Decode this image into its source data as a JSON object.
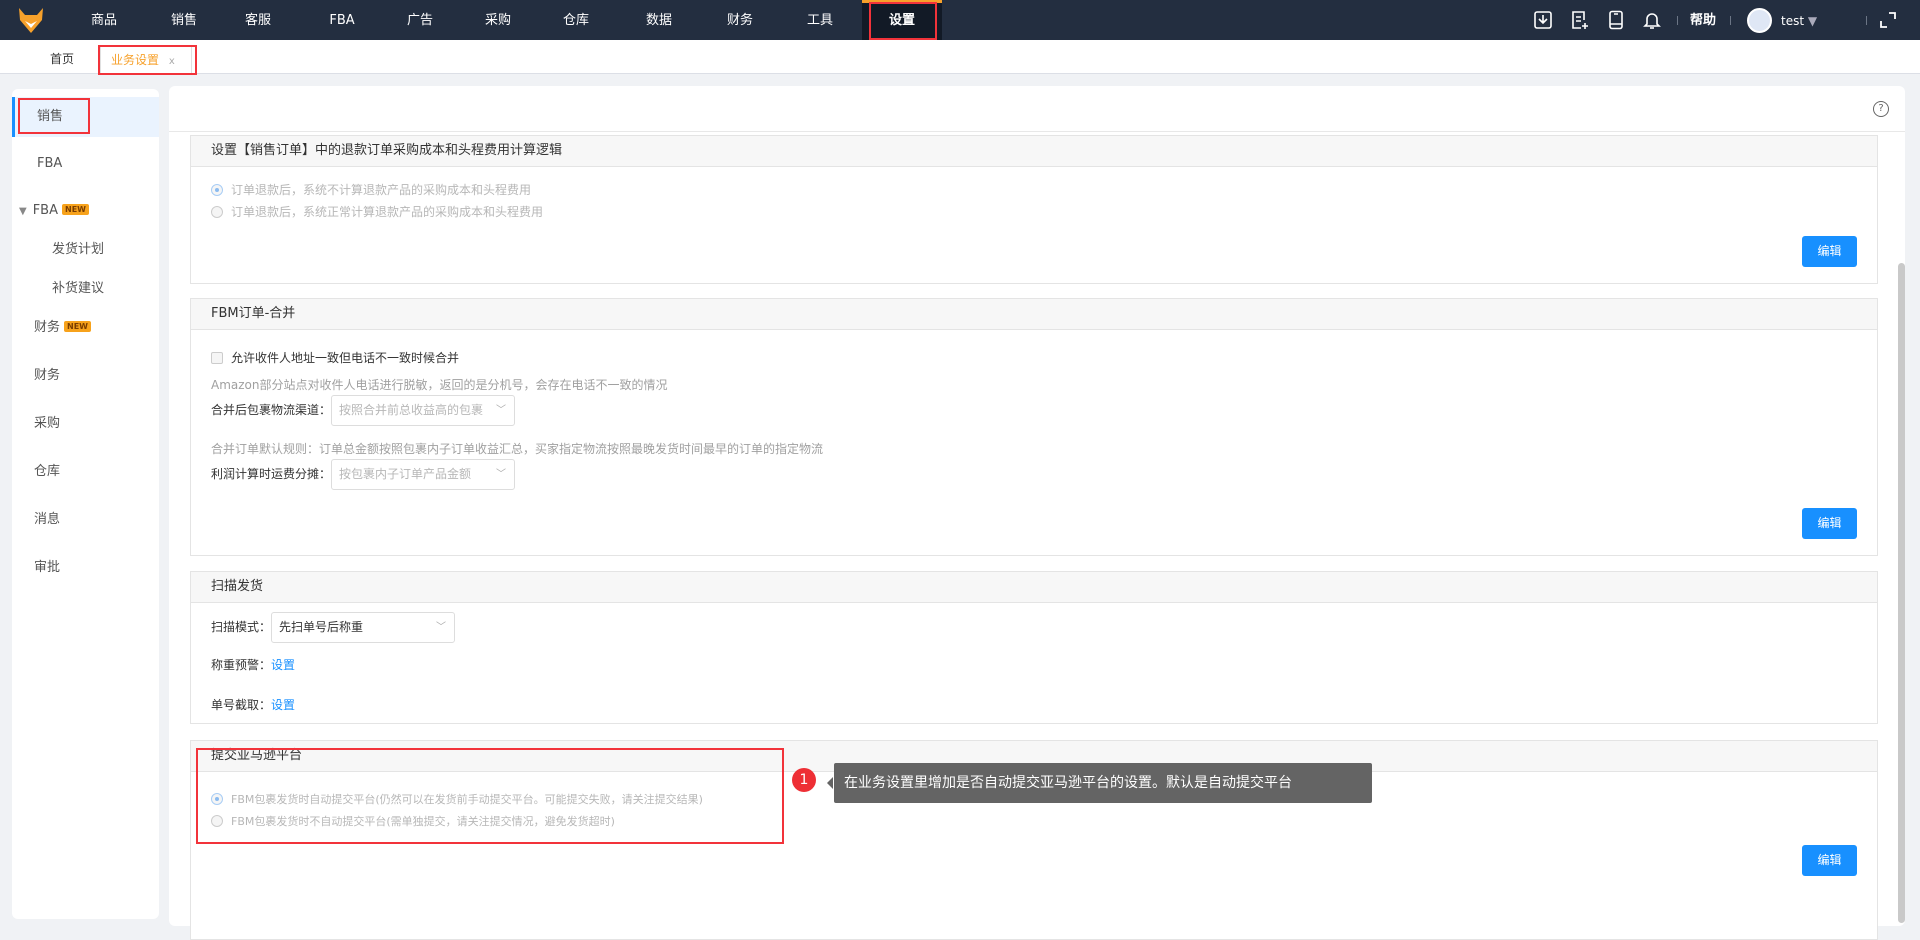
{
  "topnav": {
    "items": [
      "商品",
      "销售",
      "客服",
      "FBA",
      "广告",
      "采购",
      "仓库",
      "数据",
      "财务",
      "工具",
      "设置"
    ],
    "active": "设置",
    "help": "帮助",
    "user": "test"
  },
  "tabs": {
    "home": "首页",
    "current": "业务设置",
    "close": "x"
  },
  "sidebar": {
    "items": [
      {
        "label": "销售"
      },
      {
        "label": "FBA"
      },
      {
        "label": "FBA",
        "badge": "NEW"
      },
      {
        "label": "发货计划"
      },
      {
        "label": "补货建议"
      },
      {
        "label": "财务",
        "badge": "NEW"
      },
      {
        "label": "财务"
      },
      {
        "label": "采购"
      },
      {
        "label": "仓库"
      },
      {
        "label": "消息"
      },
      {
        "label": "审批"
      }
    ]
  },
  "main": {
    "help_icon": "?",
    "sections": [
      {
        "title": "设置【销售订单】中的退款订单采购成本和头程费用计算逻辑",
        "options": [
          "订单退款后，系统不计算退款产品的采购成本和头程费用",
          "订单退款后，系统正常计算退款产品的采购成本和头程费用"
        ],
        "edit": "编辑"
      },
      {
        "title": "FBM订单-合并",
        "checkbox": "允许收件人地址一致但电话不一致时候合并",
        "hint1": "Amazon部分站点对收件人电话进行脱敏，返回的是分机号，会存在电话不一致的情况",
        "channel_label": "合并后包裹物流渠道：",
        "channel_value": "按照合并前总收益高的包裹",
        "hint2": "合并订单默认规则：订单总金额按照包裹内子订单收益汇总，买家指定物流按照最晚发货时间最早的订单的指定物流",
        "freight_label": "利润计算时运费分摊：",
        "freight_value": "按包裹内子订单产品金额",
        "edit": "编辑"
      },
      {
        "title": "扫描发货",
        "mode_label": "扫描模式：",
        "mode_value": "先扫单号后称重",
        "weight_label": "称重预警：",
        "weight_link": "设置",
        "cut_label": "单号截取：",
        "cut_link": "设置"
      },
      {
        "title": "提交亚马逊平台",
        "options": [
          "FBM包裹发货时自动提交平台(仍然可以在发货前手动提交平台。可能提交失败，请关注提交结果)",
          "FBM包裹发货时不自动提交平台(需单独提交，请关注提交情况，避免发货超时)"
        ],
        "edit": "编辑"
      }
    ]
  },
  "annotation": {
    "number": "1",
    "text": "在业务设置里增加是否自动提交亚马逊平台的设置。默认是自动提交平台"
  }
}
